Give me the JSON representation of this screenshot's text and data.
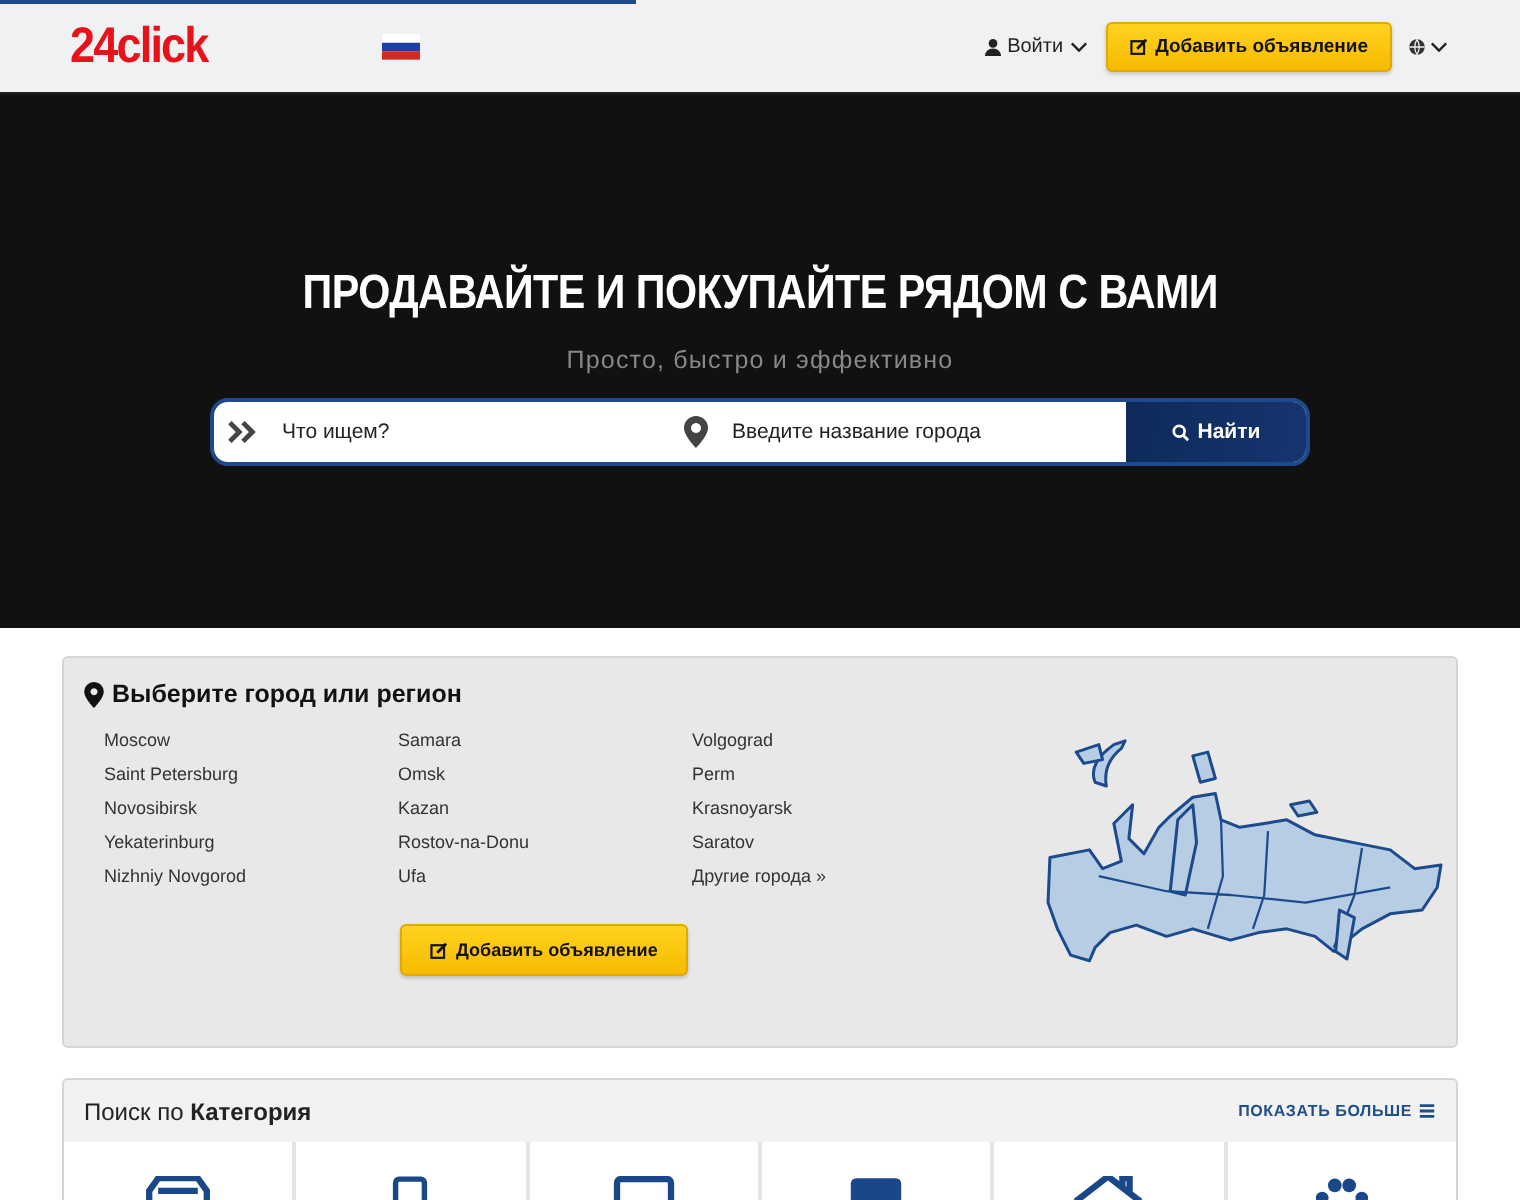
{
  "header": {
    "logo": "24click",
    "login": "Войти",
    "add_button": "Добавить объявление"
  },
  "hero": {
    "title": "ПРОДАВАЙТЕ И ПОКУПАЙТЕ РЯДОМ С ВАМИ",
    "subtitle": "Просто, быстро и эффективно",
    "search_placeholder": "Что ищем?",
    "city_placeholder": "Введите название города",
    "search_button": "Найти"
  },
  "cities": {
    "title": "Выберите город или регион",
    "columns": [
      [
        "Moscow",
        "Saint Petersburg",
        "Novosibirsk",
        "Yekaterinburg",
        "Nizhniy Novgorod"
      ],
      [
        "Samara",
        "Omsk",
        "Kazan",
        "Rostov-na-Donu",
        "Ufa"
      ],
      [
        "Volgograd",
        "Perm",
        "Krasnoyarsk",
        "Saratov",
        "Другие города »"
      ]
    ],
    "add_button": "Добавить объявление"
  },
  "categories": {
    "heading": "Поиск по **Категория**",
    "show_more": "ПОКАЗАТЬ БОЛЬШЕ"
  }
}
